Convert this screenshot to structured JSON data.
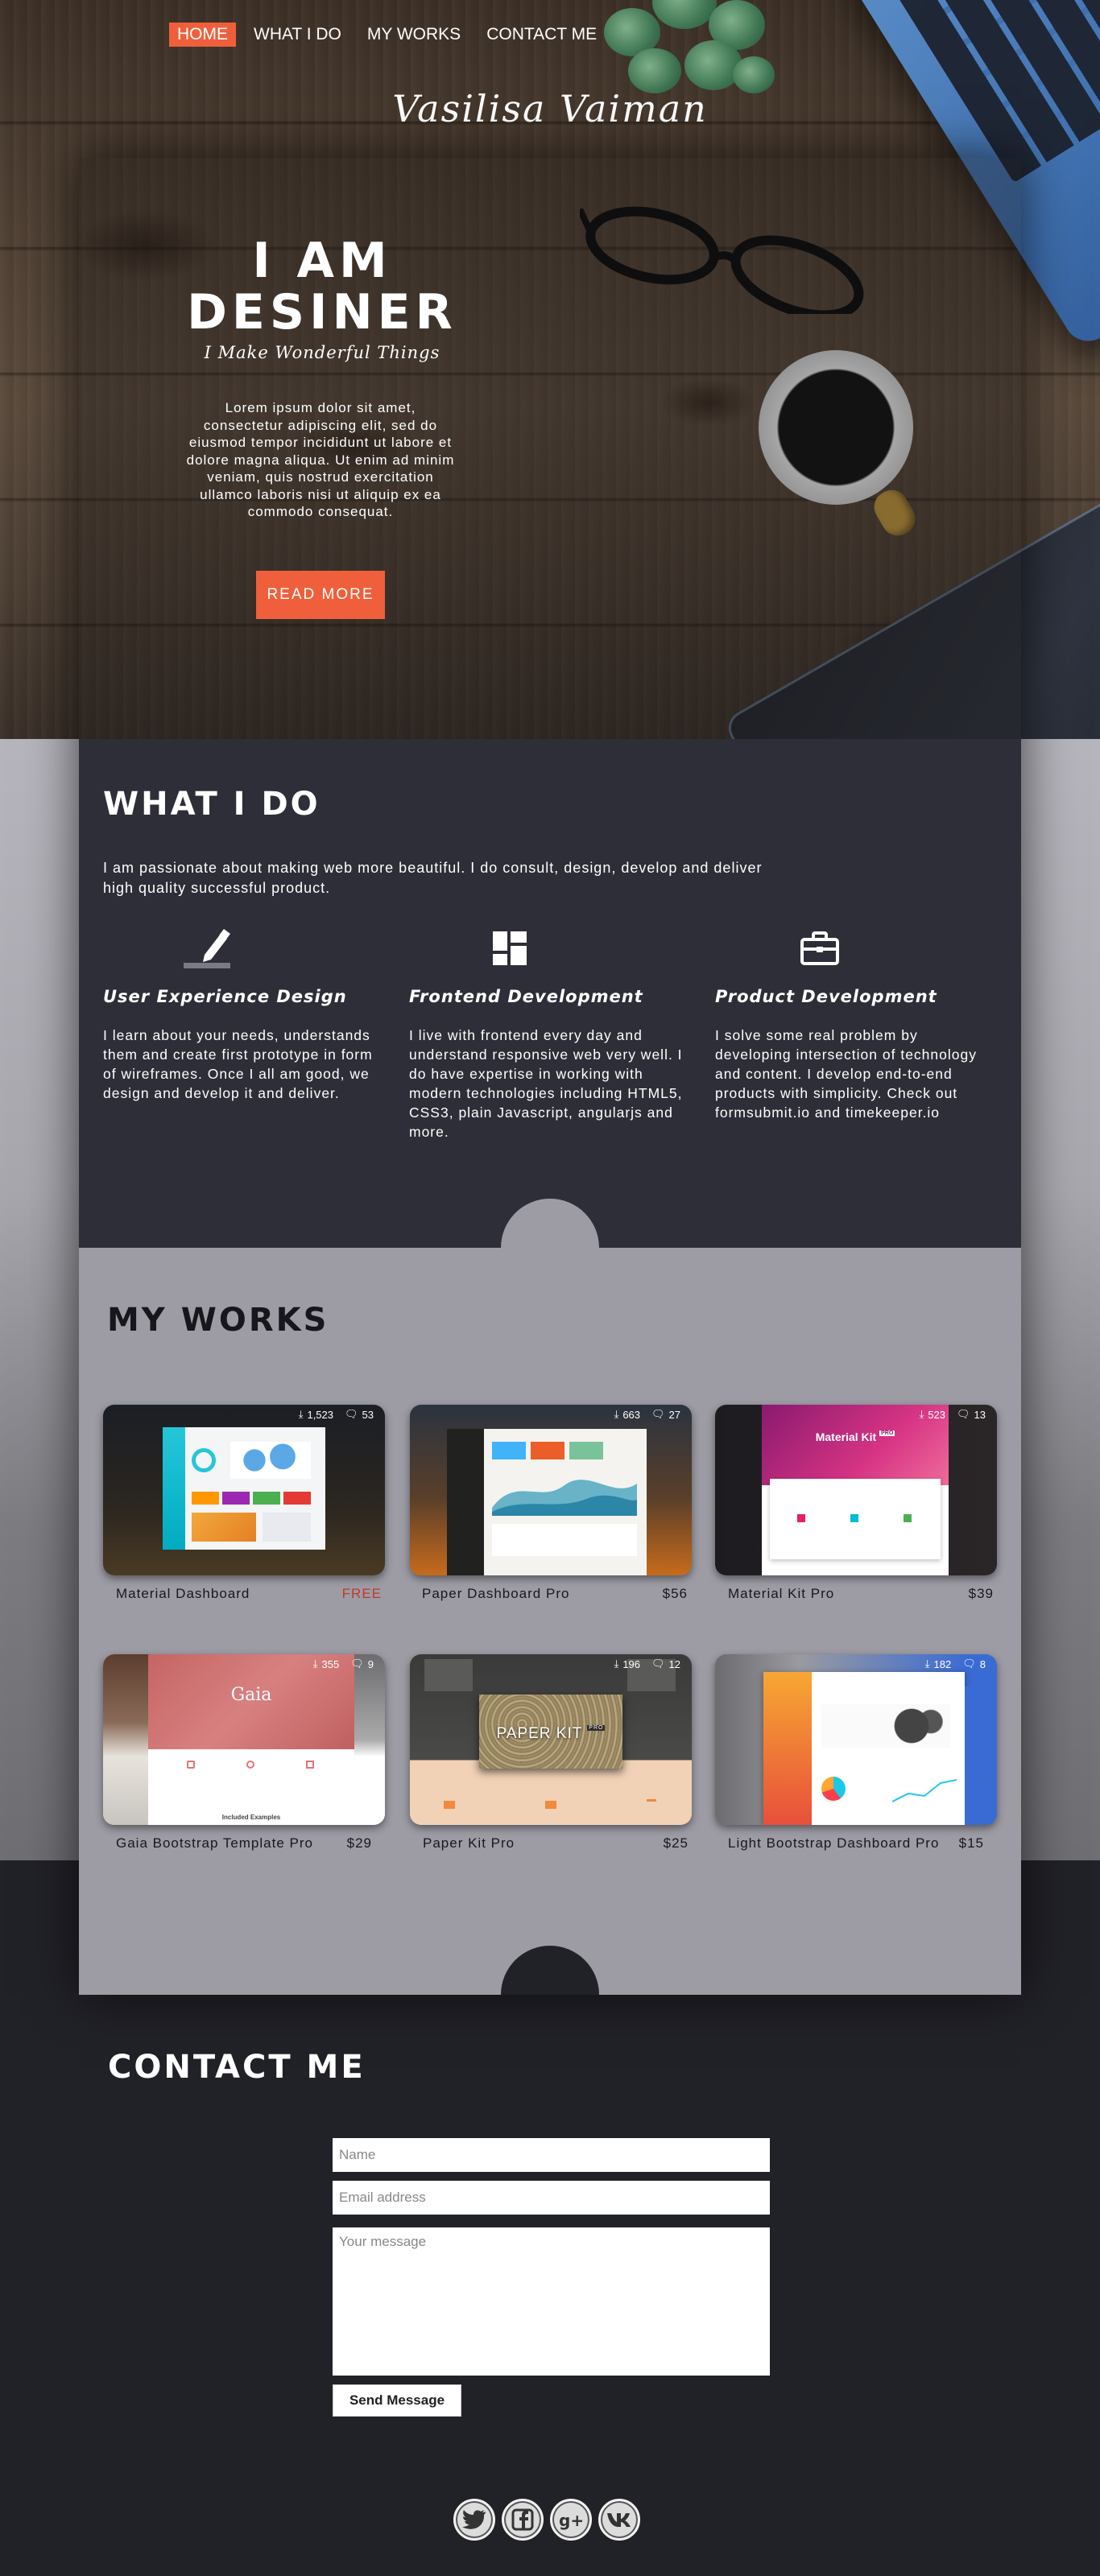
{
  "colors": {
    "accent": "#f05f3b",
    "dark_panel": "#2e2e38",
    "works_panel": "#9d9ca5",
    "footer": "#212128"
  },
  "nav": {
    "items": [
      {
        "label": "HOME",
        "active": true
      },
      {
        "label": "WHAT I DO",
        "active": false
      },
      {
        "label": "MY WORKS",
        "active": false
      },
      {
        "label": "CONTACT ME",
        "active": false
      }
    ]
  },
  "brand": {
    "name": "Vasilisa Vaiman"
  },
  "hero": {
    "title_line1": "I AM",
    "title_line2": "DESINER",
    "subtitle": "I Make Wonderful Things",
    "text": "Lorem ipsum dolor sit amet, consectetur adipiscing elit, sed do eiusmod tempor incididunt ut labore et dolore magna aliqua. Ut enim ad minim veniam, quis nostrud exercitation ullamco laboris nisi ut aliquip ex ea commodo consequat.",
    "button": "READ MORE"
  },
  "what_i_do": {
    "title": "WHAT I DO",
    "intro": "I am passionate about making web more beautiful. I do consult, design, develop and deliver high quality successful product.",
    "services": [
      {
        "icon": "pencil-icon",
        "title": "User Experience Design",
        "text": "I learn about your needs, understands them and create first prototype in form of wireframes. Once I all am good, we design and develop it and deliver."
      },
      {
        "icon": "dashboard-icon",
        "title": "Frontend Development",
        "text": "I live with frontend every day and understand responsive web very well. I do have expertise in working with modern technologies including HTML5, CSS3, plain Javascript, angularjs and more."
      },
      {
        "icon": "briefcase-icon",
        "title": "Product Development",
        "text": "I solve some real problem by developing intersection of technology and content. I develop end-to-end products with simplicity. Check out formsubmit.io and timekeeper.io"
      }
    ]
  },
  "my_works": {
    "title": "MY WORKS",
    "items": [
      {
        "name": "Material Dashboard",
        "price": "FREE",
        "downloads": "1,523",
        "comments": "53"
      },
      {
        "name": "Paper Dashboard Pro",
        "price": "$56",
        "downloads": "663",
        "comments": "27"
      },
      {
        "name": "Material Kit Pro",
        "price": "$39",
        "downloads": "523",
        "comments": "13"
      },
      {
        "name": "Gaia Bootstrap Template Pro",
        "price": "$29",
        "downloads": "355",
        "comments": "9"
      },
      {
        "name": "Paper Kit Pro",
        "price": "$25",
        "downloads": "196",
        "comments": "12"
      },
      {
        "name": "Light Bootstrap Dashboard Pro",
        "price": "$15",
        "downloads": "182",
        "comments": "8"
      }
    ],
    "thumb_text": {
      "material_kit": "Material Kit",
      "material_kit_badge": "PRO",
      "gaia": "Gaia",
      "paper_kit": "PAPER KIT",
      "paper_kit_badge": "PRO",
      "included": "Included Examples"
    }
  },
  "contact": {
    "title": "CONTACT ME",
    "name_placeholder": "Name",
    "email_placeholder": "Email address",
    "message_placeholder": "Your message",
    "send_button": "Send Message"
  },
  "social": [
    {
      "icon": "twitter-icon"
    },
    {
      "icon": "facebook-icon"
    },
    {
      "icon": "googleplus-icon"
    },
    {
      "icon": "vk-icon"
    }
  ]
}
